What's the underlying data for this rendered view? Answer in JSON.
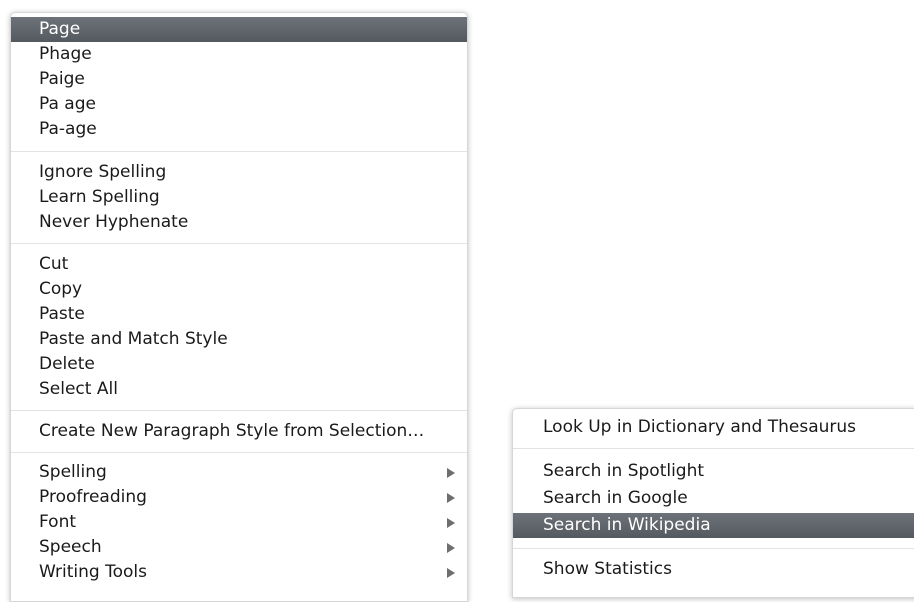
{
  "context_menu": {
    "suggestions": [
      "Page",
      "Phage",
      "Paige",
      "Pa age",
      "Pa-age"
    ],
    "spelling_actions": [
      "Ignore Spelling",
      "Learn Spelling",
      "Never Hyphenate"
    ],
    "edit_actions": [
      "Cut",
      "Copy",
      "Paste",
      "Paste and Match Style",
      "Delete",
      "Select All"
    ],
    "style_action": "Create New Paragraph Style from Selection…",
    "submenus": [
      "Spelling",
      "Proofreading",
      "Font",
      "Speech",
      "Writing Tools"
    ],
    "highlighted_item": "Page",
    "submenu_arrow_icon": "triangle-right-icon"
  },
  "services_menu": {
    "lookup": "Look Up in Dictionary and Thesaurus",
    "searches": [
      "Search in Spotlight",
      "Search in Google",
      "Search in Wikipedia"
    ],
    "stats": "Show Statistics",
    "highlighted_item": "Search in Wikipedia"
  },
  "colors": {
    "highlight": "#5f636a",
    "separator": "#e2e2e2",
    "text": "#1a1a1a"
  }
}
